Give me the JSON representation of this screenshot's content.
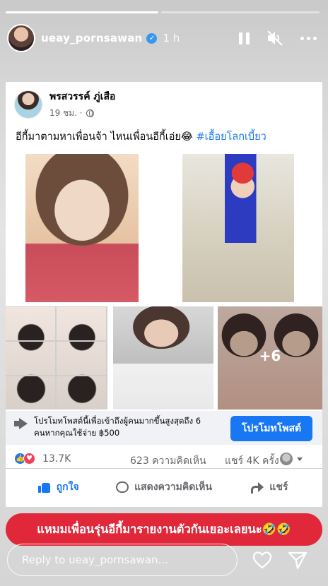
{
  "story": {
    "username": "ueay_pornsawan",
    "time": "1 h",
    "progress": [
      1,
      0
    ]
  },
  "post": {
    "author": "พรสวรรค์ ภู่เสือ",
    "time": "19 ชม. ·",
    "text": "อีกี้มาตามหาเพื่อนจ้า ไหนเพื่อนอีกี้เอ่ย😂 ",
    "hashtag": "#เอื้อยโลกเบี้ยว",
    "more_photos": "+6"
  },
  "promo": {
    "text": "โปรโมทโพสต์นี้เพื่อเข้าถึงผู้คนมากขึ้นสูงสุดถึง 6 คนหากคุณใช้จ่าย ฿500",
    "button": "โปรโมทโพสต์"
  },
  "stats": {
    "reactions": "13.7K",
    "comments": "623 ความคิดเห็น",
    "shares": "แชร์ 4K ครั้ง"
  },
  "actions": {
    "like": "ถูกใจ",
    "comment": "แสดงความคิดเห็น",
    "share": "แชร์"
  },
  "caption": "แหมมเพื่อนรุ่นอีกี้มารายงานตัวกันเยอะเลยนะ🤣🤣",
  "reply": {
    "placeholder": "Reply to ueay_pornsawan..."
  },
  "colors": {
    "facebook_blue": "#1877f2",
    "caption_red": "#e0283a",
    "love_red": "#f33e58"
  }
}
